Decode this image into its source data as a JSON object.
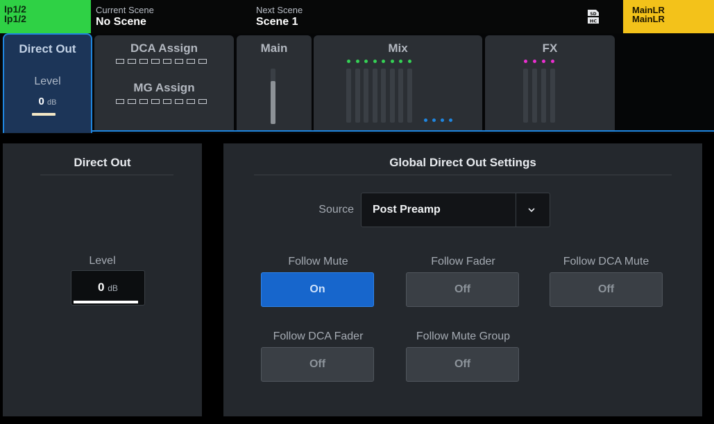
{
  "header": {
    "channel_top": "Ip1/2",
    "channel_bottom": "Ip1/2",
    "current_scene_label": "Current Scene",
    "current_scene_value": "No Scene",
    "next_scene_label": "Next Scene",
    "next_scene_value": "Scene 1",
    "sd_icon": "sd-hc-card-icon",
    "mix_top": "MainLR",
    "mix_bottom": "MainLR",
    "channel_color": "#2fd145",
    "mix_color": "#f3c21a"
  },
  "tabs": {
    "direct_out": {
      "title": "Direct Out",
      "level_label": "Level",
      "level_value": "0",
      "level_unit": "dB"
    },
    "dca_assign": {
      "title": "DCA Assign",
      "slots": 8
    },
    "mg_assign": {
      "title": "MG Assign",
      "slots": 8
    },
    "main": {
      "title": "Main",
      "meter_level": 0.78
    },
    "mix": {
      "title": "Mix",
      "green_dots": 8,
      "blue_dots": 4
    },
    "fx": {
      "title": "FX",
      "magenta_dots": 4
    },
    "accent_color": "#1f86e0"
  },
  "direct_out_panel": {
    "title": "Direct Out",
    "level_label": "Level",
    "level_value": "0",
    "level_unit": "dB"
  },
  "global_panel": {
    "title": "Global Direct Out Settings",
    "source_label": "Source",
    "source_value": "Post Preamp",
    "dropdown_icon": "chevron-down-icon",
    "follow_mute_label": "Follow Mute",
    "follow_mute_value": "On",
    "follow_fader_label": "Follow Fader",
    "follow_fader_value": "Off",
    "follow_dca_mute_label": "Follow DCA Mute",
    "follow_dca_mute_value": "Off",
    "follow_dca_fader_label": "Follow DCA Fader",
    "follow_dca_fader_value": "Off",
    "follow_mute_group_label": "Follow Mute Group",
    "follow_mute_group_value": "Off",
    "on_color": "#1766cc"
  }
}
